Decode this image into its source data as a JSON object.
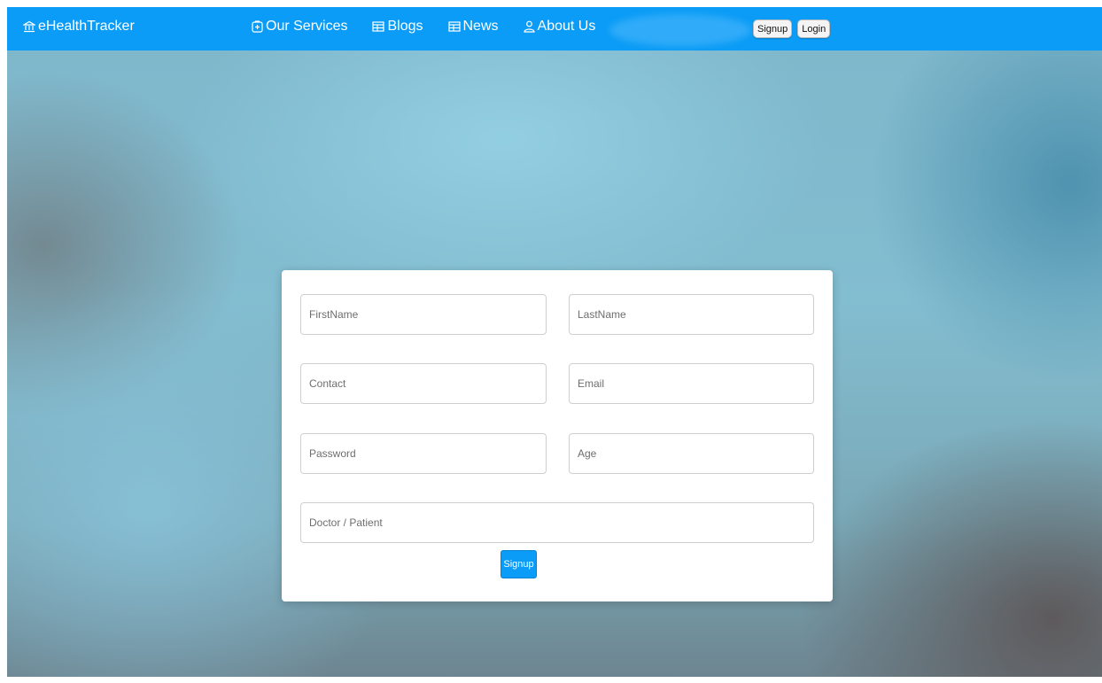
{
  "nav": {
    "brand": "eHealthTracker",
    "links": [
      {
        "label": "Our Services",
        "icon": "plus-square-icon"
      },
      {
        "label": "Blogs",
        "icon": "table-icon"
      },
      {
        "label": "News",
        "icon": "table-icon"
      },
      {
        "label": "About Us",
        "icon": "person-icon"
      }
    ],
    "signup_label": "Signup",
    "login_label": "Login"
  },
  "form": {
    "firstname_placeholder": "FirstName",
    "lastname_placeholder": "LastName",
    "contact_placeholder": "Contact",
    "email_placeholder": "Email",
    "password_placeholder": "Password",
    "age_placeholder": "Age",
    "role_placeholder": "Doctor / Patient",
    "submit_label": "Signup"
  },
  "colors": {
    "navbar": "#0a9cf6",
    "submit_button": "#0a9cf6"
  }
}
